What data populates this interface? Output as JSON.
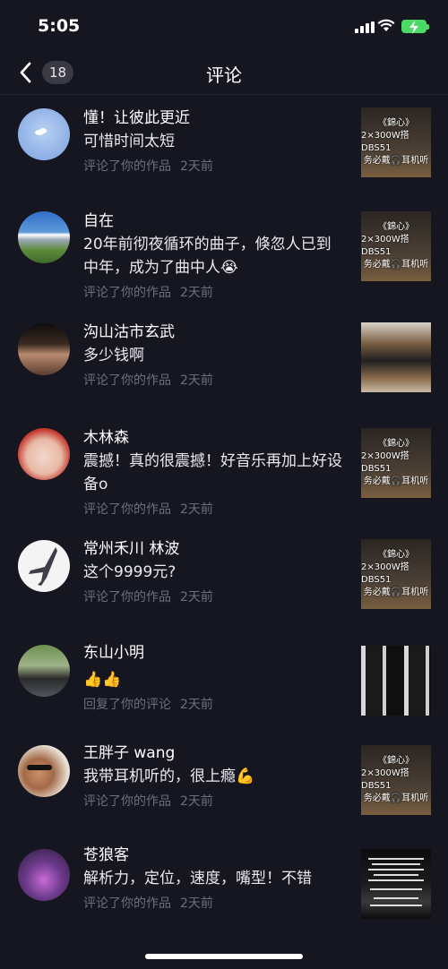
{
  "status_bar": {
    "time": "5:05",
    "battery_color": "#4cd964"
  },
  "nav": {
    "title": "评论",
    "count": "18",
    "back_icon": "chevron-left-icon"
  },
  "comments": [
    {
      "name": "懂！让彼此更近",
      "text": "可惜时间太短",
      "action": "评论了你的作品",
      "time": "2天前",
      "thumb_lines": [
        "《錦心》",
        "2×300W搭DBS51",
        "务必戴🎧耳机听"
      ]
    },
    {
      "name": "自在",
      "text": "20年前彻夜循环的曲子，倏忽人已到中年，成为了曲中人😭",
      "action": "评论了你的作品",
      "time": "2天前",
      "thumb_lines": [
        "《錦心》",
        "2×300W搭DBS51",
        "务必戴🎧耳机听"
      ]
    },
    {
      "name": "沟山沽市玄武",
      "text": "多少钱啊",
      "action": "评论了你的作品",
      "time": "2天前"
    },
    {
      "name": "木林森",
      "text": "震撼！真的很震撼！好音乐再加上好设备o",
      "action": "评论了你的作品",
      "time": "2天前",
      "thumb_lines": [
        "《錦心》",
        "2×300W搭DBS51",
        "务必戴🎧耳机听"
      ]
    },
    {
      "name": "常州禾川 林波",
      "text": "这个9999元?",
      "action": "评论了你的作品",
      "time": "2天前",
      "thumb_lines": [
        "《錦心》",
        "2×300W搭DBS51",
        "务必戴🎧耳机听"
      ]
    },
    {
      "name": "东山小明",
      "text": "👍👍",
      "action": "回复了你的评论",
      "time": "2天前"
    },
    {
      "name": "王胖子 wang",
      "text": "我带耳机听的，很上瘾💪",
      "action": "评论了你的作品",
      "time": "2天前",
      "thumb_lines": [
        "《錦心》",
        "2×300W搭DBS51",
        "务必戴🎧耳机听"
      ]
    },
    {
      "name": "苍狼客",
      "text": "解析力，定位，速度，嘴型！不错",
      "action": "评论了你的作品",
      "time": "2天前"
    }
  ]
}
